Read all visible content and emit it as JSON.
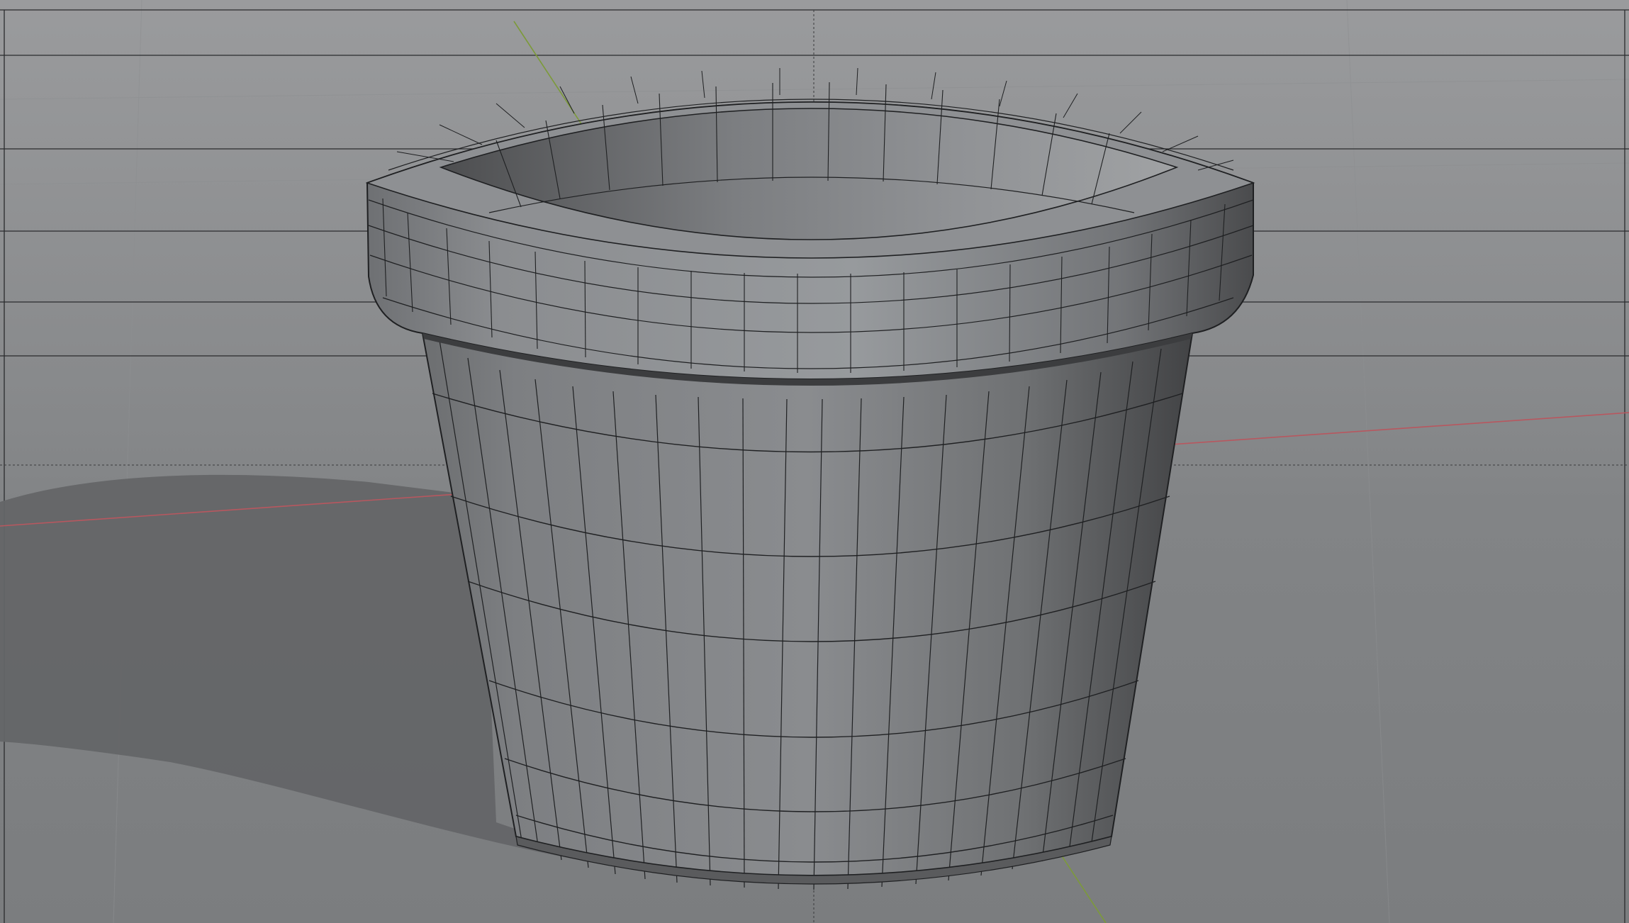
{
  "viewport": {
    "kind": "3d-viewport",
    "mode": "wireframe-over-solid",
    "object": "flower-pot-mesh",
    "object_color": "#7d7f82",
    "background_color": "#7a7c7e",
    "axis_x_color": "#b8575f",
    "axis_y_color": "#7c9a3a",
    "wire_color": "#1f2022"
  }
}
